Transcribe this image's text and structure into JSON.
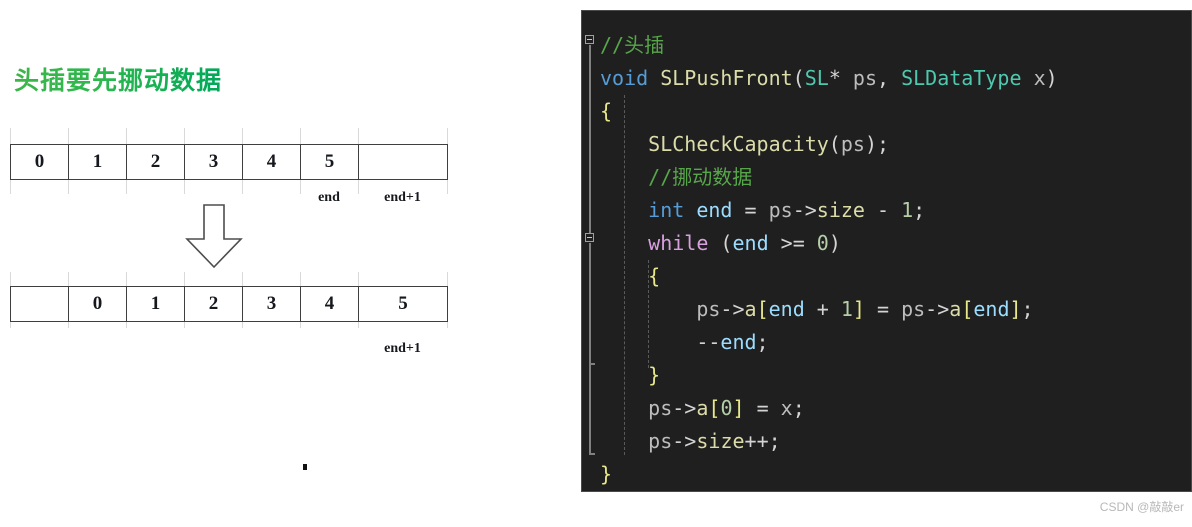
{
  "diagram": {
    "title": "头插要先挪动数据",
    "title_color": "#22b14c",
    "before": {
      "cells": [
        "0",
        "1",
        "2",
        "3",
        "4",
        "5",
        ""
      ],
      "labels": [
        {
          "text": "end",
          "cell_index": 5
        },
        {
          "text": "end+1",
          "cell_index": 6
        }
      ]
    },
    "arrow": "down-arrow",
    "after": {
      "cells": [
        "",
        "0",
        "1",
        "2",
        "3",
        "4",
        "5"
      ],
      "labels": [
        {
          "text": "end+1",
          "cell_index": 6
        }
      ]
    },
    "stray_dot": "."
  },
  "code": {
    "background": "#1f1f1f",
    "language": "c",
    "lines": [
      {
        "indent": 0,
        "tokens": [
          {
            "t": "//头插",
            "c": "comment"
          }
        ]
      },
      {
        "indent": 0,
        "tokens": [
          {
            "t": "void",
            "c": "keyword"
          },
          {
            "t": " ",
            "c": "plain"
          },
          {
            "t": "SLPushFront",
            "c": "func"
          },
          {
            "t": "(",
            "c": "punct"
          },
          {
            "t": "SL",
            "c": "type"
          },
          {
            "t": "* ",
            "c": "punct"
          },
          {
            "t": "ps",
            "c": "param"
          },
          {
            "t": ", ",
            "c": "punct"
          },
          {
            "t": "SLDataType",
            "c": "type"
          },
          {
            "t": " ",
            "c": "plain"
          },
          {
            "t": "x",
            "c": "param"
          },
          {
            "t": ")",
            "c": "punct"
          }
        ]
      },
      {
        "indent": 0,
        "tokens": [
          {
            "t": "{",
            "c": "bracket1"
          }
        ]
      },
      {
        "indent": 1,
        "tokens": [
          {
            "t": "SLCheckCapacity",
            "c": "func"
          },
          {
            "t": "(",
            "c": "punct"
          },
          {
            "t": "ps",
            "c": "param"
          },
          {
            "t": ");",
            "c": "punct"
          }
        ]
      },
      {
        "indent": 1,
        "tokens": [
          {
            "t": "//挪动数据",
            "c": "comment"
          }
        ]
      },
      {
        "indent": 1,
        "tokens": [
          {
            "t": "int",
            "c": "keyword"
          },
          {
            "t": " ",
            "c": "plain"
          },
          {
            "t": "end",
            "c": "var"
          },
          {
            "t": " = ",
            "c": "punct"
          },
          {
            "t": "ps",
            "c": "param"
          },
          {
            "t": "->",
            "c": "punct"
          },
          {
            "t": "size",
            "c": "member"
          },
          {
            "t": " - ",
            "c": "punct"
          },
          {
            "t": "1",
            "c": "num"
          },
          {
            "t": ";",
            "c": "punct"
          }
        ]
      },
      {
        "indent": 1,
        "tokens": [
          {
            "t": "while",
            "c": "control"
          },
          {
            "t": " (",
            "c": "punct"
          },
          {
            "t": "end",
            "c": "var"
          },
          {
            "t": " >= ",
            "c": "punct"
          },
          {
            "t": "0",
            "c": "num"
          },
          {
            "t": ")",
            "c": "punct"
          }
        ]
      },
      {
        "indent": 1,
        "tokens": [
          {
            "t": "{",
            "c": "bracket1"
          }
        ]
      },
      {
        "indent": 2,
        "tokens": [
          {
            "t": "ps",
            "c": "param"
          },
          {
            "t": "->",
            "c": "punct"
          },
          {
            "t": "a",
            "c": "member"
          },
          {
            "t": "[",
            "c": "bracket1"
          },
          {
            "t": "end",
            "c": "var"
          },
          {
            "t": " + ",
            "c": "punct"
          },
          {
            "t": "1",
            "c": "num"
          },
          {
            "t": "]",
            "c": "bracket1"
          },
          {
            "t": " = ",
            "c": "punct"
          },
          {
            "t": "ps",
            "c": "param"
          },
          {
            "t": "->",
            "c": "punct"
          },
          {
            "t": "a",
            "c": "member"
          },
          {
            "t": "[",
            "c": "bracket1"
          },
          {
            "t": "end",
            "c": "var"
          },
          {
            "t": "]",
            "c": "bracket1"
          },
          {
            "t": ";",
            "c": "punct"
          }
        ]
      },
      {
        "indent": 2,
        "tokens": [
          {
            "t": "--",
            "c": "punct"
          },
          {
            "t": "end",
            "c": "var"
          },
          {
            "t": ";",
            "c": "punct"
          }
        ]
      },
      {
        "indent": 1,
        "tokens": [
          {
            "t": "}",
            "c": "bracket1"
          }
        ]
      },
      {
        "indent": 1,
        "tokens": [
          {
            "t": "ps",
            "c": "param"
          },
          {
            "t": "->",
            "c": "punct"
          },
          {
            "t": "a",
            "c": "member"
          },
          {
            "t": "[",
            "c": "bracket1"
          },
          {
            "t": "0",
            "c": "num"
          },
          {
            "t": "]",
            "c": "bracket1"
          },
          {
            "t": " = ",
            "c": "punct"
          },
          {
            "t": "x",
            "c": "param"
          },
          {
            "t": ";",
            "c": "punct"
          }
        ]
      },
      {
        "indent": 1,
        "tokens": [
          {
            "t": "ps",
            "c": "param"
          },
          {
            "t": "->",
            "c": "punct"
          },
          {
            "t": "size",
            "c": "member"
          },
          {
            "t": "++;",
            "c": "punct"
          }
        ]
      },
      {
        "indent": 0,
        "tokens": [
          {
            "t": "}",
            "c": "bracket1"
          }
        ]
      }
    ]
  },
  "watermark": "CSDN @敲敲er"
}
